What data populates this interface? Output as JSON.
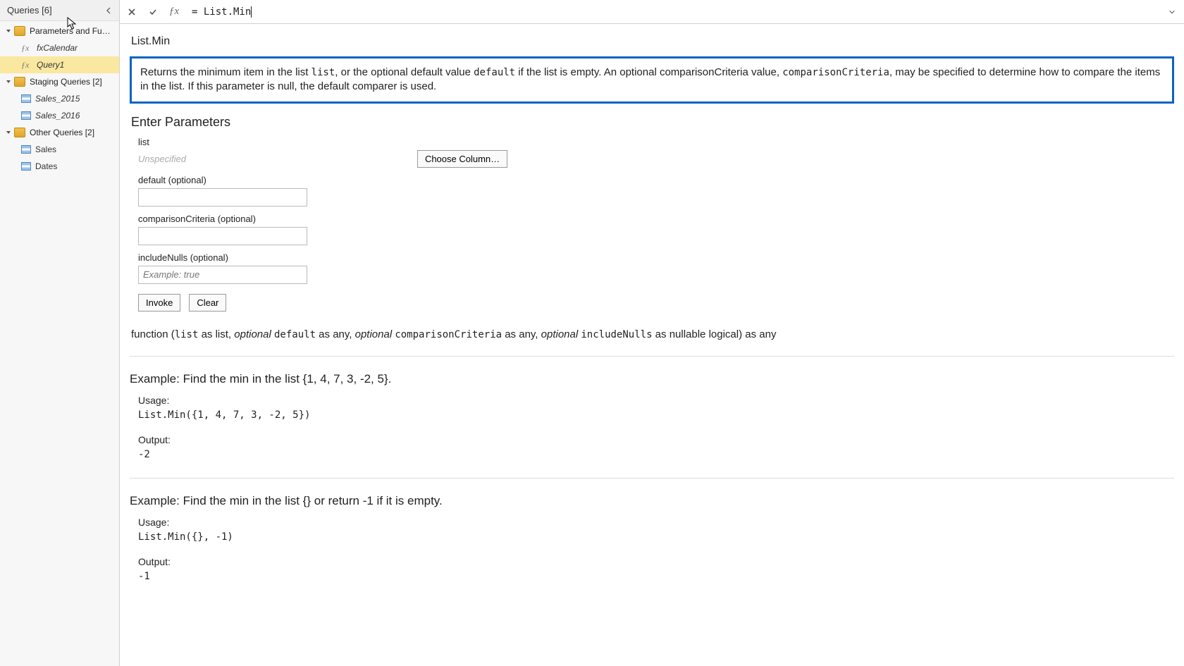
{
  "sidebar": {
    "title": "Queries [6]",
    "groups": [
      {
        "label": "Parameters and Fu…",
        "items": [
          {
            "type": "fx",
            "label": "fxCalendar",
            "selected": false
          },
          {
            "type": "fx",
            "label": "Query1",
            "selected": true
          }
        ]
      },
      {
        "label": "Staging Queries [2]",
        "items": [
          {
            "type": "tbl",
            "label": "Sales_2015",
            "style": "italic"
          },
          {
            "type": "tbl",
            "label": "Sales_2016",
            "style": "italic"
          }
        ]
      },
      {
        "label": "Other Queries [2]",
        "items": [
          {
            "type": "tbl",
            "label": "Sales",
            "style": "plain"
          },
          {
            "type": "tbl",
            "label": "Dates",
            "style": "plain"
          }
        ]
      }
    ]
  },
  "formula_bar": {
    "value": "= List.Min"
  },
  "doc": {
    "fn_name": "List.Min",
    "description": {
      "pre1": "Returns the minimum item in the list ",
      "code1": "list",
      "mid1": ", or the optional default value ",
      "code2": "default",
      "mid2": " if the list is empty. An optional comparisonCriteria value, ",
      "code3": "comparisonCriteria",
      "post": ", may be specified to determine how to compare the items in the list. If this parameter is null, the default comparer is used."
    },
    "params_header": "Enter Parameters",
    "params": {
      "p1_label": "list",
      "p1_placeholder": "Unspecified",
      "choose_btn": "Choose Column…",
      "p2_label": "default (optional)",
      "p3_label": "comparisonCriteria (optional)",
      "p4_label": "includeNulls (optional)",
      "p4_placeholder": "Example: true"
    },
    "invoke_btn": "Invoke",
    "clear_btn": "Clear",
    "signature": {
      "s1": "function (",
      "c1": "list",
      "s2": " as list, ",
      "o2": "optional",
      "sp2": " ",
      "c2": "default",
      "s3": " as any, ",
      "o3": "optional",
      "sp3": " ",
      "c3": "comparisonCriteria",
      "s4": " as any, ",
      "o4": "optional",
      "sp4": " ",
      "c4": "includeNulls",
      "s5": " as nullable logical) as any"
    },
    "ex1": {
      "title": "Example: Find the min in the list {1, 4, 7, 3, -2, 5}.",
      "usage_lbl": "Usage:",
      "usage": "List.Min({1, 4, 7, 3, -2, 5})",
      "output_lbl": "Output:",
      "output": "-2"
    },
    "ex2": {
      "title": "Example: Find the min in the list {} or return -1 if it is empty.",
      "usage_lbl": "Usage:",
      "usage": "List.Min({}, -1)",
      "output_lbl": "Output:",
      "output": "-1"
    }
  }
}
